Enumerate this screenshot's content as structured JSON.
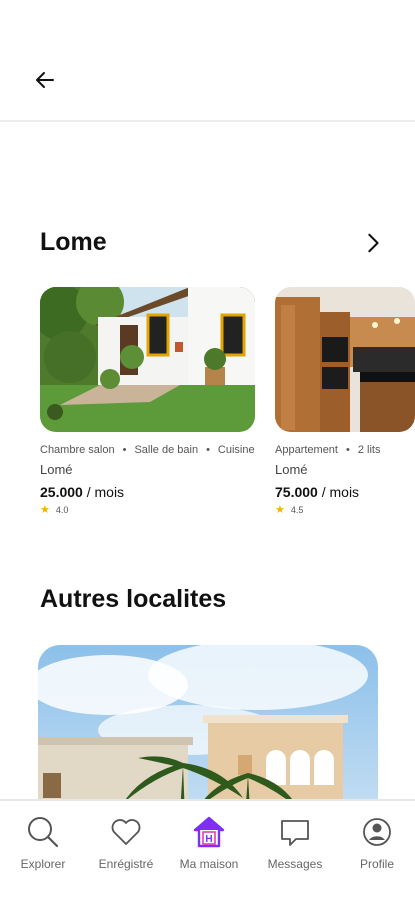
{
  "header": {
    "back_icon": "arrow-left-icon"
  },
  "sections": {
    "lome": {
      "title": "Lome",
      "chevron_icon": "chevron-right-icon"
    },
    "autres": {
      "title": "Autres localites"
    }
  },
  "listings": [
    {
      "features": [
        "Chambre salon",
        "Salle de bain",
        "Cuisine"
      ],
      "city": "Lomé",
      "price": "25.000",
      "period": "/ mois",
      "rating": "4.0"
    },
    {
      "features": [
        "Appartement",
        "2 lits"
      ],
      "city": "Lomé",
      "price": "75.000",
      "period": "/ mois",
      "rating": "4.5"
    }
  ],
  "bullet": "•",
  "nav": {
    "items": [
      {
        "label": "Explorer",
        "icon": "search-icon"
      },
      {
        "label": "Enrégistré",
        "icon": "heart-icon"
      },
      {
        "label": "Ma maison",
        "icon": "house-icon",
        "active": true
      },
      {
        "label": "Messages",
        "icon": "message-icon"
      },
      {
        "label": "Profile",
        "icon": "user-icon"
      }
    ],
    "accent_color": "#7b2ff7"
  }
}
